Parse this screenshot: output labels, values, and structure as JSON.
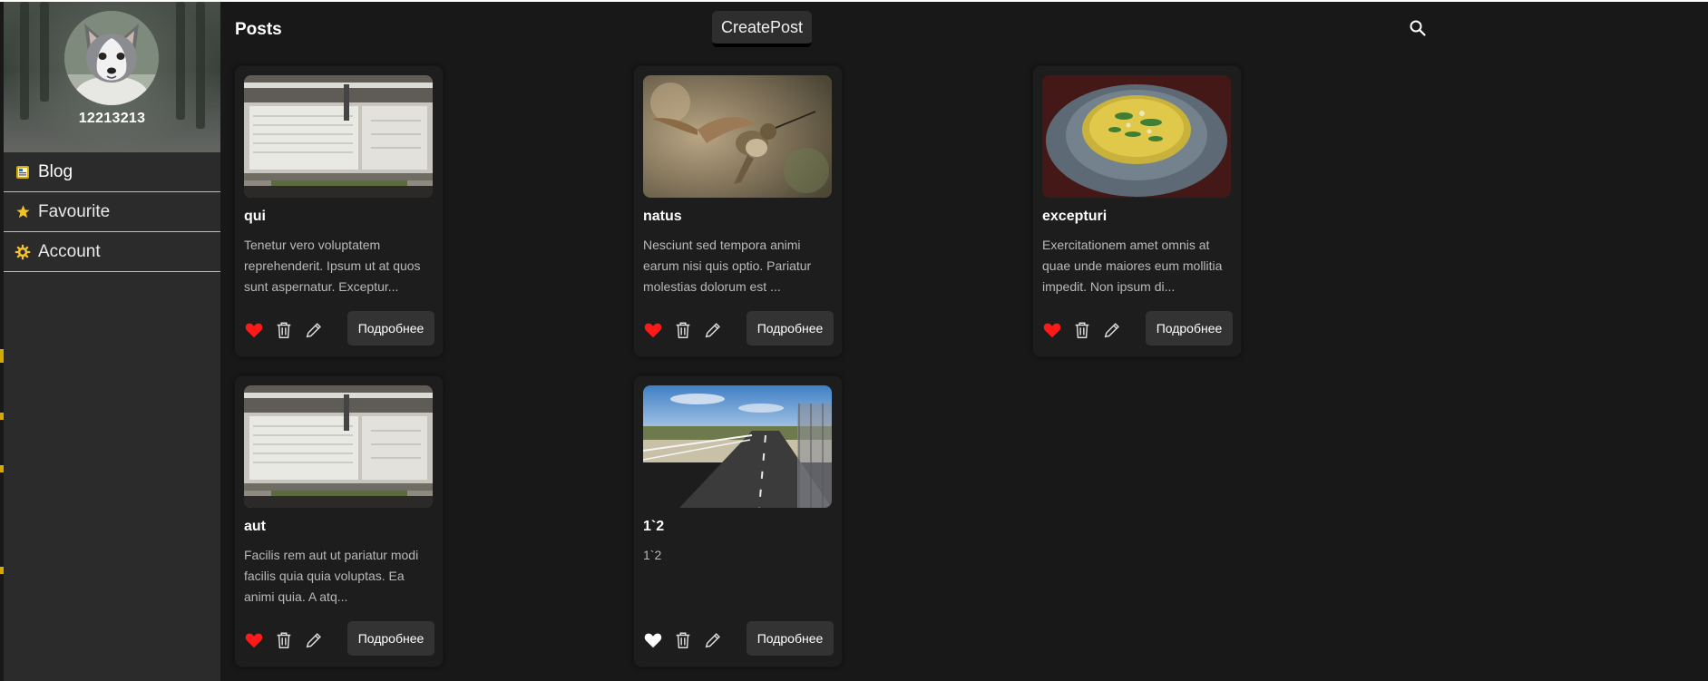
{
  "profile": {
    "username": "12213213"
  },
  "sidebar": {
    "items": [
      {
        "label": "Blog",
        "icon": "blog-icon"
      },
      {
        "label": "Favourite",
        "icon": "star-icon"
      },
      {
        "label": "Account",
        "icon": "gear-icon"
      }
    ]
  },
  "header": {
    "title": "Posts",
    "create_label": "CreatePost",
    "search_icon": "search-icon"
  },
  "posts": [
    {
      "title": "qui",
      "body": "Tenetur vero voluptatem reprehenderit. Ipsum ut at quos sunt aspernatur. Exceptur...",
      "liked": true,
      "more_label": "Подробнее",
      "image": "classroom whiteboard"
    },
    {
      "title": "natus",
      "body": "Nesciunt sed tempora animi earum nisi quis optio. Pariatur molestias dolorum est ...",
      "liked": true,
      "more_label": "Подробнее",
      "image": "hummingbird"
    },
    {
      "title": "excepturi",
      "body": "Exercitationem amet omnis at quae unde maiores eum mollitia impedit. Non ipsum di...",
      "liked": true,
      "more_label": "Подробнее",
      "image": "pasta dish"
    },
    {
      "title": "aut",
      "body": "Facilis rem aut ut pariatur modi facilis quia quia voluptas. Ea animi quia. A atq...",
      "liked": true,
      "more_label": "Подробнее",
      "image": "classroom whiteboard"
    },
    {
      "title": "1`2",
      "body": "1`2",
      "liked": false,
      "more_label": "Подробнее",
      "image": "road path"
    }
  ],
  "colors": {
    "accent": "#d4a900",
    "like_red": "#ff0000",
    "background": "#181818",
    "sidebar": "#2b2b2b"
  }
}
